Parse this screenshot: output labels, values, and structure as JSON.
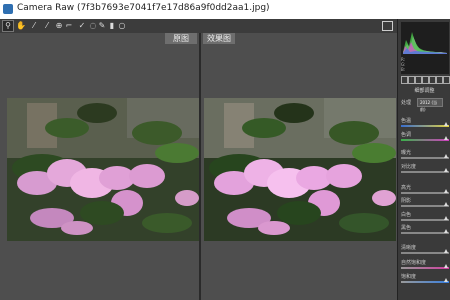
{
  "window": {
    "title": "Camera Raw (7f3b7693e7041f7e17d86a9f0dd2aa1.jpg)"
  },
  "toolbar": {
    "tools": [
      {
        "icon": "zoom-icon",
        "glyph": "⚲"
      },
      {
        "icon": "hand-icon",
        "glyph": "✋"
      },
      {
        "icon": "white-balance-icon",
        "glyph": "⁄"
      },
      {
        "icon": "color-sampler-icon",
        "glyph": "⁄"
      },
      {
        "icon": "target-adjust-icon",
        "glyph": "⊕"
      },
      {
        "icon": "crop-icon",
        "glyph": "⌐"
      },
      {
        "icon": "straighten-icon",
        "glyph": "⟋"
      },
      {
        "icon": "spot-removal-icon",
        "glyph": "✓"
      },
      {
        "icon": "red-eye-icon",
        "glyph": "◌"
      },
      {
        "icon": "adjustment-brush-icon",
        "glyph": "✎"
      },
      {
        "icon": "graduated-filter-icon",
        "glyph": "▮"
      },
      {
        "icon": "radial-filter-icon",
        "glyph": "○"
      }
    ]
  },
  "view": {
    "before_label": "原图",
    "after_label": "效果图"
  },
  "panel": {
    "histogram_rows": [
      "R:",
      "G:",
      "B:"
    ],
    "section_title": "细部调整",
    "process_label": "处理",
    "process_value": "2012 (当前)",
    "rows": [
      "色温",
      "色调",
      "曝光",
      "对比度",
      "高光",
      "阴影",
      "白色",
      "黑色",
      "清晰度",
      "自然饱和度",
      "饱和度"
    ]
  }
}
